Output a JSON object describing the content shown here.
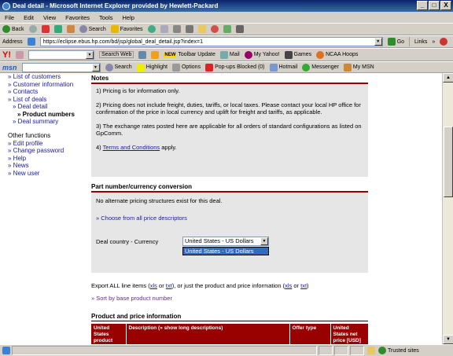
{
  "window": {
    "title": "Deal detail - Microsoft Internet Explorer provided by Hewlett-Packard",
    "btn_min": "_",
    "btn_max": "□",
    "btn_close": "X"
  },
  "menubar": [
    "File",
    "Edit",
    "View",
    "Favorites",
    "Tools",
    "Help"
  ],
  "toolbar": {
    "back": "Back",
    "search": "Search",
    "favorites": "Favorites"
  },
  "address": {
    "label": "Address",
    "url": "https://eclipse.ebus.hp.com/bd/jsp/global_deal_detail.jsp?index=1",
    "go": "Go",
    "links": "Links"
  },
  "yahoo": {
    "search_web": "Search Web",
    "new_badge": "NEW",
    "toolbar_update": "Toolbar Update",
    "mail": "Mail",
    "my_yahoo": "My Yahoo!",
    "games": "Games",
    "ncaa": "NCAA Hoops"
  },
  "msn": {
    "logo": "msn",
    "search": "Search",
    "highlight": "Highlight",
    "options": "Options",
    "popups": "Pop-ups Blocked (0)",
    "hotmail": "Hotmail",
    "messenger": "Messenger",
    "my_msn": "My MSN"
  },
  "leftnav": {
    "items": [
      "List of customers",
      "Customer information",
      "Contacts",
      "List of deals"
    ],
    "sub_items": [
      "Deal detail"
    ],
    "current": "Product numbers",
    "deal_summary": "Deal summary",
    "other_heading": "Other functions",
    "other_items": [
      "Edit profile",
      "Change password",
      "Help",
      "News",
      "New user"
    ]
  },
  "notes": {
    "title": "Notes",
    "p1": "1) Pricing is for information only.",
    "p2": "2) Pricing does not include freight, duties, tariffs, or local taxes. Please contact your local HP office for confirmation of the price in local currency and uplift for freight and tariffs, as applicable.",
    "p3": "3) The exchange rates posted here are applicable for all orders of standard configurations as listed on GpComm.",
    "p4_prefix": "4) ",
    "p4_link": "Terms and Conditions",
    "p4_suffix": " apply."
  },
  "conversion": {
    "title": "Part number/currency conversion",
    "no_alt": "No alternate pricing structures exist for this deal.",
    "choose": "» Choose from all price descriptors",
    "label": "Deal country - Currency",
    "selected": "United States - US Dollars",
    "dropdown_option": "United States - US Dollars"
  },
  "export": {
    "prefix": "Export ALL line items (",
    "xls": "xls",
    "or": " or ",
    "txt": "txt",
    "middle": "), or just the product and price information (",
    "xls2": "xls",
    "or2": " or ",
    "txt2": "txt",
    "suffix": ")",
    "sort": "» Sort by base product number"
  },
  "ppi": {
    "title": "Product and price information",
    "headers": [
      "United States product number",
      "Description (» show long descriptions)",
      "Offer type",
      "United States net price [USD]"
    ]
  },
  "status": {
    "zone": "Trusted sites"
  },
  "colors": {
    "accent": "#990000",
    "link": "#1a1aa6",
    "panel": "#e6e6e6"
  }
}
